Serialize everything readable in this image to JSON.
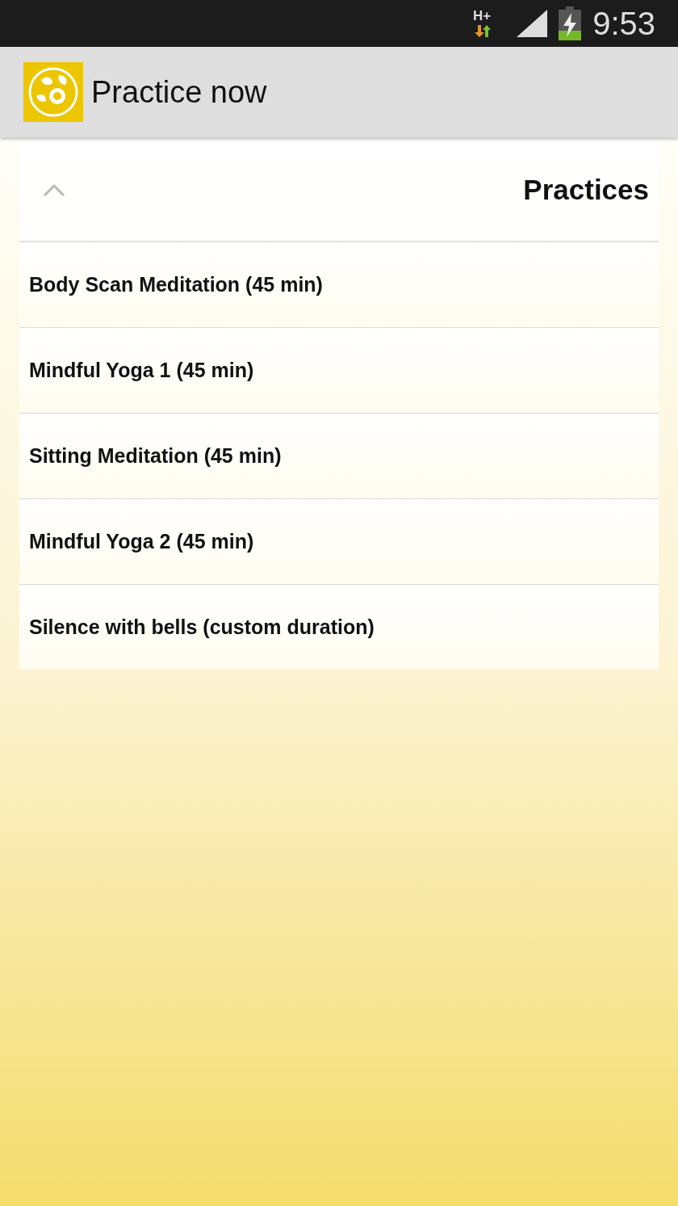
{
  "status_bar": {
    "network": "H+",
    "time": "9:53"
  },
  "app_bar": {
    "title": "Practice now"
  },
  "practices": {
    "title": "Practices",
    "expanded": true,
    "items": [
      {
        "label": "Body Scan Meditation (45 min)"
      },
      {
        "label": "Mindful Yoga 1 (45 min)"
      },
      {
        "label": "Sitting Meditation (45 min)"
      },
      {
        "label": "Mindful Yoga 2 (45 min)"
      },
      {
        "label": "Silence with bells (custom duration)"
      }
    ]
  }
}
